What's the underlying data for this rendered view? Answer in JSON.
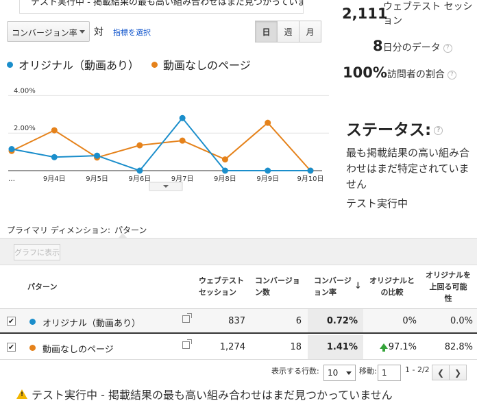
{
  "top_banner": {
    "text": "テスト実行中 - 掲載結果の最も高い組み合わせはまだ見つかっていません"
  },
  "controls": {
    "metric": "コンバージョン率",
    "vs": "対",
    "choose_metric": "指標を選択",
    "periods": [
      "日",
      "週",
      "月"
    ],
    "active_period": "日"
  },
  "legend": [
    {
      "name": "オリジナル（動画あり）",
      "color": "#1b8ecb"
    },
    {
      "name": "動画なしのページ",
      "color": "#e5821b"
    }
  ],
  "chart_data": {
    "type": "line",
    "categories": [
      "…",
      "9月4日",
      "9月5日",
      "9月6日",
      "9月7日",
      "9月8日",
      "9月9日",
      "9月10日"
    ],
    "ytick_labels": [
      "4.00%",
      "2.00%"
    ],
    "ylim": [
      0,
      4.6
    ],
    "grid": true,
    "series": [
      {
        "name": "オリジナル（動画あり）",
        "color": "#1b8ecb",
        "values": [
          1.15,
          0.72,
          0.8,
          0.0,
          2.8,
          0.0,
          0.0,
          0.0
        ]
      },
      {
        "name": "動画なしのページ",
        "color": "#e5821b",
        "values": [
          1.05,
          2.15,
          0.7,
          1.35,
          1.6,
          0.6,
          2.55,
          0.0
        ]
      }
    ]
  },
  "stats": {
    "sessions_value": "2,111",
    "sessions_label": "ウェブテスト セッション",
    "days_value": "8",
    "days_label": "日分のデータ",
    "visitors_value": "100%",
    "visitors_label": "訪問者の割合"
  },
  "status": {
    "title": "ステータス:",
    "text": "最も掲載結果の高い組み合わせはまだ特定されていません",
    "sub": "テスト実行中"
  },
  "primary_dimension": {
    "label": "プライマリ ディメンション:",
    "value": "パターン"
  },
  "toolbar": {
    "graph_button": "グラフに表示"
  },
  "table": {
    "headers": {
      "pattern": "パターン",
      "sessions": [
        "ウェブテスト",
        "セッション"
      ],
      "conversions": [
        "コンバージョ",
        "ン数"
      ],
      "conv_rate": [
        "コンバージ",
        "ョン率"
      ],
      "compare": [
        "オリジナルと",
        "の比較"
      ],
      "probability": [
        "オリジナルを",
        "上回る可能",
        "性"
      ]
    },
    "rows": [
      {
        "name": "オリジナル（動画あり）",
        "color": "#1b8ecb",
        "checked": "✔",
        "sessions": "837",
        "conversions": "6",
        "conv_rate": "0.72%",
        "compare": "0%",
        "probability": "0.0%"
      },
      {
        "name": "動画なしのページ",
        "color": "#e5821b",
        "checked": "✔",
        "sessions": "1,274",
        "conversions": "18",
        "conv_rate": "1.41%",
        "compare": "97.1%",
        "probability": "82.8%"
      }
    ]
  },
  "pagination": {
    "rows_label": "表示する行数:",
    "rows_value": "10",
    "goto_label": "移動:",
    "goto_value": "1",
    "range": "1 - 2/2"
  },
  "warning": {
    "text": "テスト実行中 - 掲載結果の最も高い組み合わせはまだ見つかっていません"
  }
}
